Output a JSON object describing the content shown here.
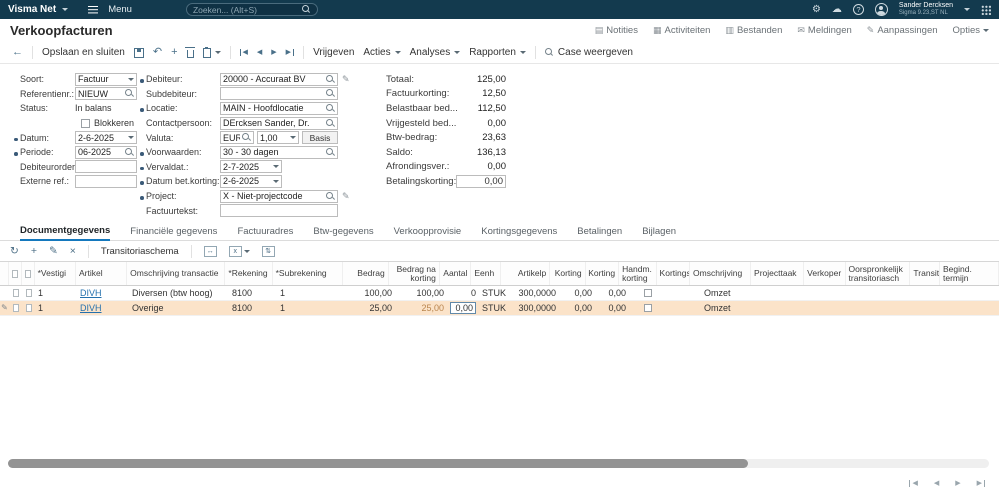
{
  "topbar": {
    "brand": "Visma Net",
    "menu": "Menu",
    "search_placeholder": "Zoeken... (Alt+S)",
    "user": {
      "name": "Sander Dercksen",
      "org": "Sigma 9.23,ST NL"
    }
  },
  "header": {
    "title": "Verkoopfacturen",
    "links": {
      "notities": "Notities",
      "activiteiten": "Activiteiten",
      "bestanden": "Bestanden",
      "meldingen": "Meldingen",
      "aanpassingen": "Aanpassingen",
      "opties": "Opties"
    }
  },
  "toolbar": {
    "opslaan_en_sluiten": "Opslaan en sluiten",
    "vrijgeven": "Vrijgeven",
    "acties": "Acties",
    "analyses": "Analyses",
    "rapporten": "Rapporten",
    "case_weergeven": "Case weergeven"
  },
  "form": {
    "soort": {
      "label": "Soort:",
      "value": "Factuur"
    },
    "referentienr": {
      "label": "Referentienr.:",
      "value": "NIEUW"
    },
    "status": {
      "label": "Status:",
      "value": "In balans"
    },
    "blokkeren": {
      "label": "Blokkeren"
    },
    "datum": {
      "label": "Datum:",
      "value": "2-6-2025"
    },
    "periode": {
      "label": "Periode:",
      "value": "06-2025"
    },
    "debiteurorder": {
      "label": "Debiteurorder:",
      "value": ""
    },
    "externe_ref": {
      "label": "Externe ref.:",
      "value": ""
    },
    "debiteur": {
      "label": "Debiteur:",
      "value": "20000 - Accuraat BV"
    },
    "subdebiteur": {
      "label": "Subdebiteur:",
      "value": ""
    },
    "locatie": {
      "label": "Locatie:",
      "value": "MAIN - Hoofdlocatie"
    },
    "contactpersoon": {
      "label": "Contactpersoon:",
      "value": "DErcksen Sander, Dr."
    },
    "valuta": {
      "label": "Valuta:",
      "currency": "EUR",
      "rate": "1,00",
      "basis": "Basis"
    },
    "voorwaarden": {
      "label": "Voorwaarden:",
      "value": "30 - 30 dagen"
    },
    "vervaldat": {
      "label": "Vervaldat.:",
      "value": "2-7-2025"
    },
    "datum_bet_korting": {
      "label": "Datum bet.korting:",
      "value": "2-6-2025"
    },
    "project": {
      "label": "Project:",
      "value": "X - Niet-projectcode"
    },
    "factuurtekst": {
      "label": "Factuurtekst:",
      "value": ""
    }
  },
  "totals": {
    "totaal": {
      "label": "Totaal:",
      "value": "125,00"
    },
    "factuurkorting": {
      "label": "Factuurkorting:",
      "value": "12,50"
    },
    "belastbaar": {
      "label": "Belastbaar bed...",
      "value": "112,50"
    },
    "vrijgesteld": {
      "label": "Vrijgesteld bed...",
      "value": "0,00"
    },
    "btw_bedrag": {
      "label": "Btw-bedrag:",
      "value": "23,63"
    },
    "saldo": {
      "label": "Saldo:",
      "value": "136,13"
    },
    "afrondingsver": {
      "label": "Afrondingsver.:",
      "value": "0,00"
    },
    "betalingskorting": {
      "label": "Betalingskorting:",
      "value": "0,00"
    }
  },
  "tabs": [
    "Documentgegevens",
    "Financiële gegevens",
    "Factuuradres",
    "Btw-gegevens",
    "Verkoopprovisie",
    "Kortingsgegevens",
    "Betalingen",
    "Bijlagen"
  ],
  "grid": {
    "transitoriaschema": "Transitoriaschema",
    "columns": [
      "*Vestigi",
      "Artikel",
      "Omschrijving transactie",
      "*Rekening",
      "*Subrekening",
      "Bedrag",
      "Bedrag na korting",
      "Aantal",
      "Eenh",
      "Artikelp",
      "Korting",
      "Korting",
      "Handm. korting",
      "Kortingsco",
      "Omschrijving",
      "Projecttaak",
      "Verkoper",
      "Oorspronkelijk transitoriasch",
      "Transito",
      "Begind. termijn"
    ],
    "rows": [
      {
        "vestiging": "1",
        "artikel": "DIVH",
        "omschrijving_transactie": "Diversen (btw hoog)",
        "rekening": "8100",
        "subrekening": "1",
        "bedrag": "100,00",
        "bedrag_na_korting": "100,00",
        "aantal": "0",
        "eenheid": "STUK",
        "artikelprijs": "300,0000",
        "korting_pct": "0,00",
        "korting_bedrag": "0,00",
        "omschrijving": "Omzet"
      },
      {
        "vestiging": "1",
        "artikel": "DIVH",
        "omschrijving_transactie": "Overige",
        "rekening": "8100",
        "subrekening": "1",
        "bedrag": "25,00",
        "bedrag_na_korting": "25,00",
        "aantal": "0,00",
        "eenheid": "STUK",
        "artikelprijs": "300,0000",
        "korting_pct": "0,00",
        "korting_bedrag": "0,00",
        "omschrijving": "Omzet"
      }
    ]
  }
}
